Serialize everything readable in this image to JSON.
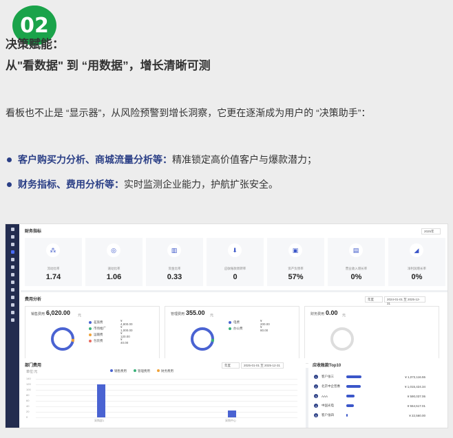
{
  "badge": "02",
  "heading": {
    "line1": "决策赋能：",
    "line2": "从\"看数据\" 到 “用数据”，增长清晰可测"
  },
  "intro": "看板也不止是 “显示器”，从风险预警到增长洞察，它更在逐渐成为用户的 “决策助手”：",
  "bullets": [
    {
      "strong": "客户购买力分析、商城流量分析等：",
      "text": "精准锁定高价值客户与爆款潜力；"
    },
    {
      "strong": "财务指标、费用分析等：",
      "text": "实时监测企业能力，护航扩张安全。"
    }
  ],
  "colors": {
    "accent": "#2b3f86",
    "badge": "#1aa34a",
    "sidebar": "#232c4f",
    "bar": "#4a63d2",
    "ring_orange": "#f0a33a",
    "ring_blue": "#4a63d2"
  },
  "dashboard": {
    "finance": {
      "title": "财务指标",
      "period": "2025年",
      "kpis": [
        {
          "icon": "network-icon",
          "glyph": "⁂",
          "label": "流动比率",
          "value": "1.74"
        },
        {
          "icon": "ring-icon",
          "glyph": "◎",
          "label": "速动比率",
          "value": "1.06"
        },
        {
          "icon": "bar-chart-icon",
          "glyph": "▥",
          "label": "资金比率",
          "value": "0.33"
        },
        {
          "icon": "arrow-down-icon",
          "glyph": "⬇",
          "label": "应收账款周转率",
          "value": "0"
        },
        {
          "icon": "building-icon",
          "glyph": "▣",
          "label": "资产负债率",
          "value": "57%"
        },
        {
          "icon": "trash-icon",
          "glyph": "▤",
          "label": "营业收入增长率",
          "value": "0%"
        },
        {
          "icon": "trend-icon",
          "glyph": "◢",
          "label": "净利润增长率",
          "value": "0%"
        }
      ]
    },
    "expense": {
      "title": "费用分析",
      "range_type": "年度",
      "range": "2024-01-01 至 2025-12-31",
      "cards": [
        {
          "title": "销售费用",
          "value": "6,020.00",
          "unit": "元",
          "items": [
            {
              "label": "差旅费",
              "amount": "¥ 4,800.00"
            },
            {
              "label": "市场推广",
              "amount": "¥ 1,000.00"
            },
            {
              "label": "运输费",
              "amount": "¥ 120.00"
            },
            {
              "label": "包装费",
              "amount": "¥ 40.00"
            }
          ]
        },
        {
          "title": "管理费用",
          "value": "355.00",
          "unit": "元",
          "items": [
            {
              "label": "电费",
              "amount": "¥ 200.00"
            },
            {
              "label": "办公费",
              "amount": "¥ 80.00"
            }
          ]
        },
        {
          "title": "财务费用",
          "value": "0.00",
          "unit": "元",
          "items": []
        }
      ]
    },
    "dept": {
      "title": "部门费用",
      "range_type": "年度",
      "range": "2025-01-01 至 2025-12-31",
      "unit_label": "单位:元",
      "legend": [
        "销售费用",
        "管理费用",
        "财务费用"
      ],
      "chart_data": {
        "type": "bar",
        "categories": [
          "采购部1",
          "采购中心"
        ],
        "series": [
          {
            "name": "销售费用",
            "values": [
              120,
              25
            ]
          }
        ],
        "yticks": [
          "140",
          "120",
          "100",
          "80",
          "60",
          "40",
          "20",
          "0"
        ],
        "ylim": [
          0,
          140
        ]
      }
    },
    "ranking": {
      "title": "应收账款Top10",
      "rows": [
        {
          "rank": "1",
          "name": "客户张三",
          "amount": "¥ 1,072,116.55",
          "share": 1.0
        },
        {
          "rank": "2",
          "name": "北京中企普惠",
          "amount": "¥ 1,015,424.34",
          "share": 0.95
        },
        {
          "rank": "3",
          "name": "AAA",
          "amount": "¥ 590,037.06",
          "share": 0.55
        },
        {
          "rank": "4",
          "name": "中国光电",
          "amount": "¥ 554,517.01",
          "share": 0.52
        },
        {
          "rank": "5",
          "name": "客户张四",
          "amount": "¥ 22,560.00",
          "share": 0.03
        }
      ]
    }
  }
}
